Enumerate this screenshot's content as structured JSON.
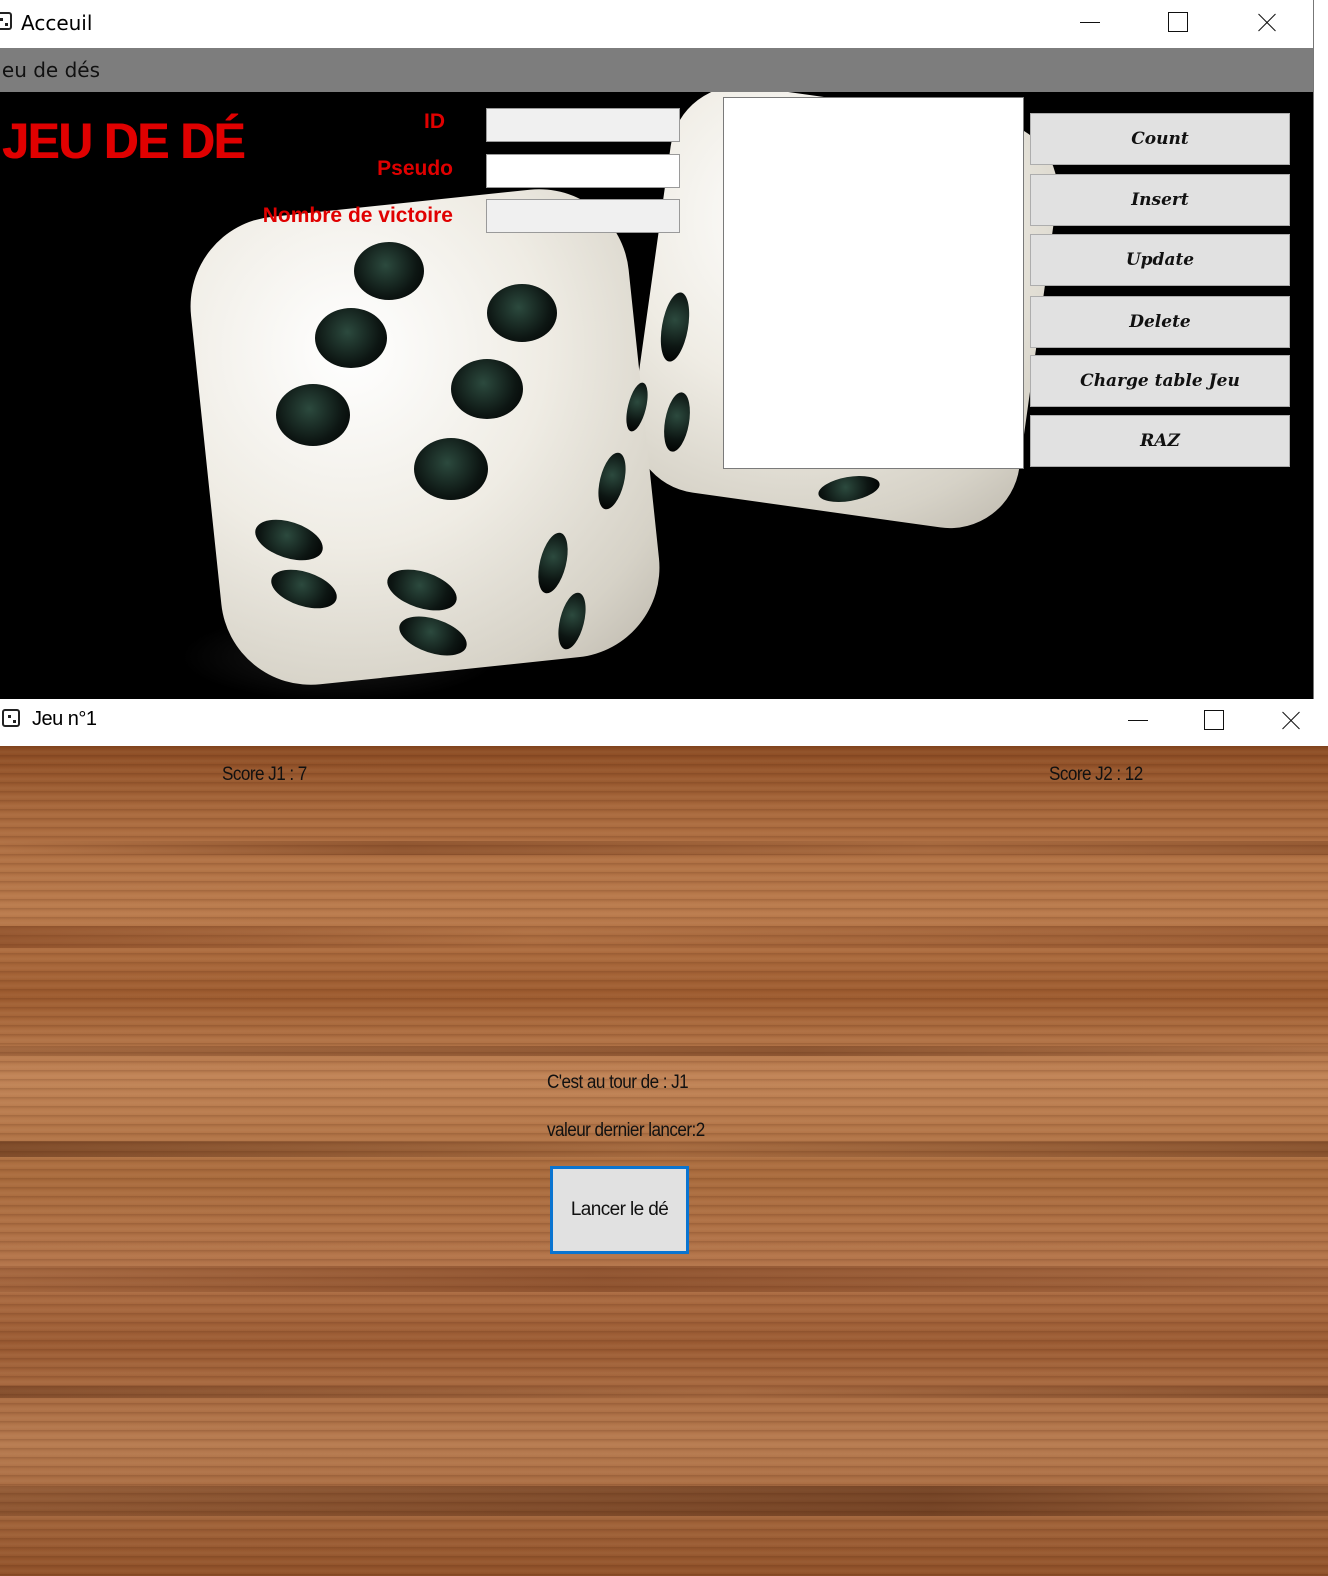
{
  "acceuil_window": {
    "title": "Acceuil",
    "menu": {
      "item": "Jeu de dés"
    },
    "app_title": "JEU DE DÉ",
    "form": {
      "id_label": "ID",
      "id_value": "",
      "pseudo_label": "Pseudo",
      "pseudo_value": "",
      "victoires_label": "Nombre de victoire",
      "victoires_value": ""
    },
    "buttons": {
      "count": "Count",
      "insert": "Insert",
      "update": "Update",
      "delete": "Delete",
      "charge": "Charge table Jeu",
      "raz": "RAZ"
    }
  },
  "jeu_window": {
    "title": "Jeu n°1",
    "score_j1": "Score J1 : 7",
    "score_j2": "Score J2 : 12",
    "tour": "C'est au tour de : J1",
    "dernier_lancer": "valeur dernier lancer:2",
    "roll_button": "Lancer le dé"
  },
  "colors": {
    "accent_red": "#e00000",
    "focus_blue": "#0a74d0",
    "menubar_gray": "#7d7d7d"
  },
  "icons": [
    "dice-app-icon",
    "minimize-icon",
    "maximize-icon",
    "close-icon"
  ]
}
